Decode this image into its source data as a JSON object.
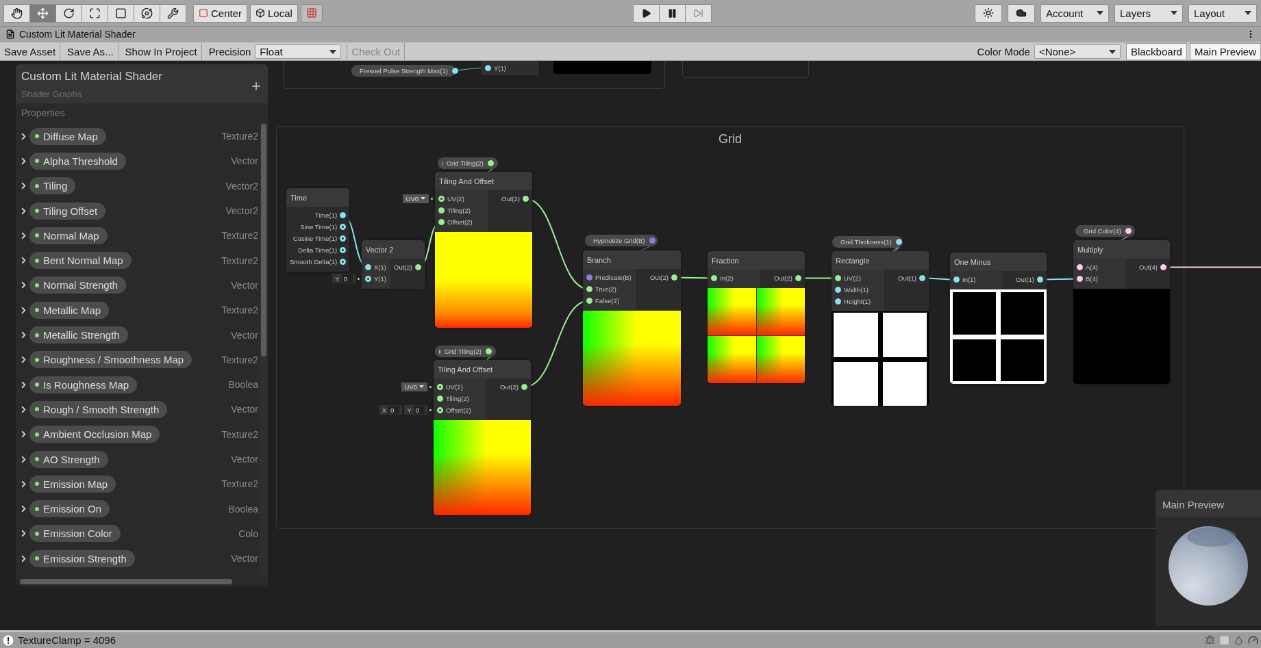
{
  "toolbar": {
    "tools": [
      {
        "selected": false
      },
      {
        "selected": true
      },
      {
        "selected": false
      },
      {
        "selected": false
      },
      {
        "selected": false
      },
      {
        "selected": false
      },
      {
        "selected": false
      }
    ],
    "pivot_buttons": [
      {
        "label": "Center"
      },
      {
        "label": "Local"
      }
    ],
    "menus": [
      {
        "label": "Account"
      },
      {
        "label": "Layers"
      },
      {
        "label": "Layout"
      }
    ]
  },
  "window": {
    "title": "Custom Lit Material Shader"
  },
  "graph_toolbar": {
    "buttons": [
      {
        "label": "Save Asset"
      },
      {
        "label": "Save As..."
      },
      {
        "label": "Show In Project"
      }
    ],
    "precision_label": "Precision",
    "precision_value": "Float",
    "check_out": {
      "label": "Check Out",
      "disabled": true
    },
    "color_mode_label": "Color Mode",
    "color_mode_value": "<None>",
    "toggles": [
      {
        "label": "Blackboard",
        "on": true
      },
      {
        "label": "Main Preview",
        "on": true
      }
    ]
  },
  "blackboard": {
    "title": "Custom Lit Material Shader",
    "subtitle": "Shader Graphs",
    "section": "Properties",
    "properties": [
      {
        "name": "Diffuse Map",
        "type": "Texture2",
        "expanded": false
      },
      {
        "name": "Alpha Threshold",
        "type": "Vector",
        "expanded": false
      },
      {
        "name": "Tiling",
        "type": "Vector2",
        "expanded": false
      },
      {
        "name": "Tiling Offset",
        "type": "Vector2",
        "expanded": false
      },
      {
        "name": "Normal Map",
        "type": "Texture2",
        "expanded": false
      },
      {
        "name": "Bent Normal Map",
        "type": "Texture2",
        "expanded": false
      },
      {
        "name": "Normal Strength",
        "type": "Vector",
        "expanded": false
      },
      {
        "name": "Metallic Map",
        "type": "Texture2",
        "expanded": false
      },
      {
        "name": "Metallic Strength",
        "type": "Vector",
        "expanded": false
      },
      {
        "name": "Roughness / Smoothness Map",
        "type": "Texture2",
        "expanded": false
      },
      {
        "name": "Is Roughness Map",
        "type": "Boolea",
        "expanded": false
      },
      {
        "name": "Rough / Smooth Strength",
        "type": "Vector",
        "expanded": false
      },
      {
        "name": "Ambient Occlusion Map",
        "type": "Texture2",
        "expanded": false
      },
      {
        "name": "AO Strength",
        "type": "Vector",
        "expanded": false
      },
      {
        "name": "Emission Map",
        "type": "Texture2",
        "expanded": false
      },
      {
        "name": "Emission On",
        "type": "Boolea",
        "expanded": false
      },
      {
        "name": "Emission Color",
        "type": "Colo",
        "expanded": false
      },
      {
        "name": "Emission Strength",
        "type": "Vector",
        "expanded": false
      }
    ]
  },
  "canvas": {
    "fragment": {
      "pill": {
        "label": "Fresnel Pulse Strength Max(1)",
        "color": "#84e4e7"
      },
      "port": {
        "label": "Y(1)",
        "color": "#84e4e7"
      }
    },
    "group_title": "Grid",
    "property_pills": [
      {
        "label": "Grid Tiling(2)",
        "color": "#9aef92"
      },
      {
        "label": "Grid Tiling(2)",
        "color": "#9aef92"
      },
      {
        "label": "Hypnotize Grid(B)",
        "color": "#8c7ae6"
      },
      {
        "label": "Grid Thickness(1)",
        "color": "#84e4e7"
      },
      {
        "label": "Grid Color(4)",
        "color": "#fbcbf4"
      }
    ],
    "nodes": [
      {
        "title": "Time",
        "kind": "plain",
        "outputs": [
          {
            "label": "Time(1)",
            "color": "#84e4e7",
            "connected": true
          },
          {
            "label": "Sine Time(1)",
            "color": "#84e4e7",
            "connected": false
          },
          {
            "label": "Cosine Time(1)",
            "color": "#84e4e7",
            "connected": false
          },
          {
            "label": "Delta Time(1)",
            "color": "#84e4e7",
            "connected": false
          },
          {
            "label": "Smooth Delta(1)",
            "color": "#84e4e7",
            "connected": false
          }
        ]
      },
      {
        "title": "Vector 2",
        "kind": "plain",
        "inputs": [
          {
            "label": "X(1)",
            "color": "#84e4e7",
            "connected": true
          },
          {
            "label": "Y(1)",
            "color": "#84e4e7",
            "connected": false,
            "field": {
              "kind": "vector",
              "components": [
                {
                  "axis": "Y",
                  "value": "0"
                }
              ]
            }
          }
        ],
        "outputs": [
          {
            "label": "Out(2)",
            "color": "#9aef92",
            "connected": true
          }
        ]
      },
      {
        "title": "Tiling And Offset",
        "kind": "offset-uv",
        "inputs": [
          {
            "label": "UV(2)",
            "color": "#9aef92",
            "connected": false,
            "field": {
              "kind": "dropdown",
              "value": "UV0"
            }
          },
          {
            "label": "Tiling(2)",
            "color": "#9aef92",
            "connected": true
          },
          {
            "label": "Offset(2)",
            "color": "#9aef92",
            "connected": true
          }
        ],
        "outputs": [
          {
            "label": "Out(2)",
            "color": "#9aef92",
            "connected": true
          }
        ]
      },
      {
        "title": "Tiling And Offset",
        "kind": "uv",
        "inputs": [
          {
            "label": "UV(2)",
            "color": "#9aef92",
            "connected": false,
            "field": {
              "kind": "dropdown",
              "value": "UV0"
            }
          },
          {
            "label": "Tiling(2)",
            "color": "#9aef92",
            "connected": true
          },
          {
            "label": "Offset(2)",
            "color": "#9aef92",
            "connected": false,
            "field": {
              "kind": "vector",
              "components": [
                {
                  "axis": "X",
                  "value": "0"
                },
                {
                  "axis": "Y",
                  "value": "0"
                }
              ]
            }
          }
        ],
        "outputs": [
          {
            "label": "Out(2)",
            "color": "#9aef92",
            "connected": true
          }
        ]
      },
      {
        "title": "Branch",
        "kind": "uv",
        "inputs": [
          {
            "label": "Predicate(B)",
            "color": "#8c7ae6",
            "connected": true
          },
          {
            "label": "True(2)",
            "color": "#9aef92",
            "connected": true
          },
          {
            "label": "False(2)",
            "color": "#9aef92",
            "connected": true
          }
        ],
        "outputs": [
          {
            "label": "Out(2)",
            "color": "#9aef92",
            "connected": true
          }
        ]
      },
      {
        "title": "Fraction",
        "kind": "tiled-uv",
        "inputs": [
          {
            "label": "In(2)",
            "color": "#9aef92",
            "connected": true
          }
        ],
        "outputs": [
          {
            "label": "Out(2)",
            "color": "#9aef92",
            "connected": true
          }
        ]
      },
      {
        "title": "Rectangle",
        "kind": "white-grid",
        "inputs": [
          {
            "label": "UV(2)",
            "color": "#9aef92",
            "connected": true
          },
          {
            "label": "Width(1)",
            "color": "#84e4e7",
            "connected": true
          },
          {
            "label": "Height(1)",
            "color": "#84e4e7",
            "connected": true
          }
        ],
        "outputs": [
          {
            "label": "Out(1)",
            "color": "#84e4e7",
            "connected": true
          }
        ]
      },
      {
        "title": "One Minus",
        "kind": "black-grid",
        "inputs": [
          {
            "label": "In(1)",
            "color": "#84e4e7",
            "connected": true
          }
        ],
        "outputs": [
          {
            "label": "Out(1)",
            "color": "#84e4e7",
            "connected": true
          }
        ]
      },
      {
        "title": "Multiply",
        "kind": "black",
        "inputs": [
          {
            "label": "A(4)",
            "color": "#fbcbf4",
            "connected": true
          },
          {
            "label": "B(4)",
            "color": "#fbcbf4",
            "connected": true
          }
        ],
        "outputs": [
          {
            "label": "Out(4)",
            "color": "#fbcbf4",
            "connected": true
          }
        ]
      }
    ]
  },
  "main_preview": {
    "title": "Main Preview"
  },
  "status_bar": {
    "message": "TextureClamp = 4096"
  }
}
